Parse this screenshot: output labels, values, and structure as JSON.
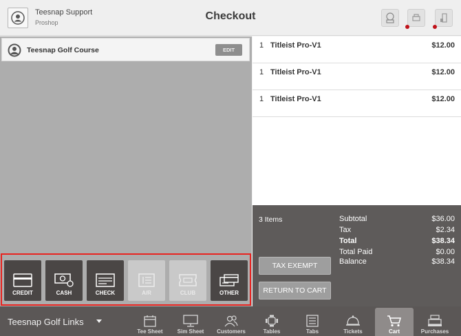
{
  "header": {
    "user_name": "Teesnap Support",
    "user_role": "Proshop",
    "title": "Checkout",
    "icons": [
      "receipt-printer-icon",
      "printer-icon",
      "cash-drawer-icon"
    ]
  },
  "customer": {
    "name": "Teesnap Golf Course",
    "edit_label": "EDIT"
  },
  "payment_methods": [
    {
      "label": "CREDIT",
      "icon": "credit-card-icon",
      "enabled": true
    },
    {
      "label": "CASH",
      "icon": "cash-icon",
      "enabled": true
    },
    {
      "label": "CHECK",
      "icon": "check-icon",
      "enabled": true
    },
    {
      "label": "A/R",
      "icon": "ar-icon",
      "enabled": false
    },
    {
      "label": "CLUB",
      "icon": "club-icon",
      "enabled": false
    },
    {
      "label": "OTHER",
      "icon": "other-payment-icon",
      "enabled": true
    }
  ],
  "cart": {
    "items": [
      {
        "qty": "1",
        "name": "Titleist Pro-V1",
        "price": "$12.00"
      },
      {
        "qty": "1",
        "name": "Titleist Pro-V1",
        "price": "$12.00"
      },
      {
        "qty": "1",
        "name": "Titleist Pro-V1",
        "price": "$12.00"
      }
    ]
  },
  "summary": {
    "item_count": "3 Items",
    "subtotal_label": "Subtotal",
    "subtotal": "$36.00",
    "tax_label": "Tax",
    "tax": "$2.34",
    "total_label": "Total",
    "total": "$38.34",
    "paid_label": "Total Paid",
    "paid": "$0.00",
    "balance_label": "Balance",
    "balance": "$38.34",
    "tax_exempt_label": "TAX EXEMPT",
    "return_label": "RETURN TO CART"
  },
  "nav": {
    "location": "Teesnap Golf Links",
    "items": [
      {
        "label": "Tee Sheet",
        "icon": "calendar-icon"
      },
      {
        "label": "Sim Sheet",
        "icon": "monitor-icon"
      },
      {
        "label": "Customers",
        "icon": "customers-icon"
      },
      {
        "label": "Tables",
        "icon": "tables-icon"
      },
      {
        "label": "Tabs",
        "icon": "tabs-icon"
      },
      {
        "label": "Tickets",
        "icon": "bell-icon"
      },
      {
        "label": "Cart",
        "icon": "cart-icon",
        "active": true
      },
      {
        "label": "Purchases",
        "icon": "register-icon"
      }
    ]
  },
  "colors": {
    "dark_button": "#4a4645",
    "disabled_button": "#c9c9c9",
    "highlight_border": "#e8231f",
    "summary_bg": "#5e5b5a",
    "nav_bg": "#5b5756",
    "alert_dot": "#c0121a"
  }
}
